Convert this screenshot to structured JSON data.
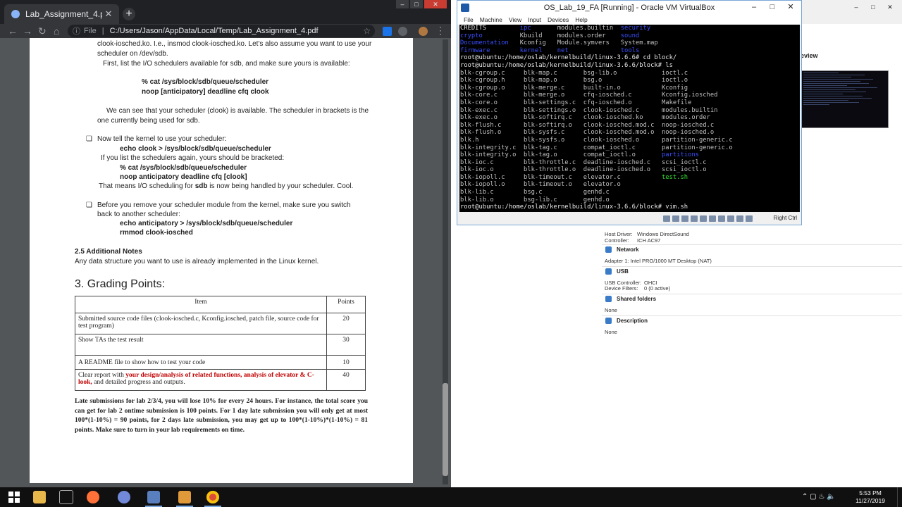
{
  "chrome": {
    "tab_title": "Lab_Assignment_4.pdf",
    "tab_close": "✕",
    "new_tab": "+",
    "omnibox_label": "File",
    "url": "C:/Users/Jason/AppData/Local/Temp/Lab_Assignment_4.pdf"
  },
  "pdf": {
    "line1": "clook-iosched.ko. I.e., insmod clook-iosched.ko. Let's also assume you want to use your",
    "line2": "scheduler on /dev/sdb.",
    "line3": "First, list the I/O schedulers available for sdb, and make sure yours is available:",
    "cmd1": "% cat /sys/block/sdb/queue/scheduler",
    "cmd1_out": "noop [anticipatory] deadline cfq clook",
    "para2_l1": "We can see that your scheduler (clook) is available. The scheduler in brackets is the",
    "para2_l2": "one currently being used for sdb.",
    "bullet1": "Now tell the kernel to use your scheduler:",
    "bullet1_cmd": "echo clook > /sys/block/sdb/queue/scheduler",
    "bullet1_l2": "If you list the schedulers again, yours should be bracketed:",
    "bullet1_cmd2": "% cat /sys/block/sdb/queue/scheduler",
    "bullet1_out": "noop anticipatory deadline cfq [clook]",
    "bullet1_l3_pre": "That means I/O scheduling for ",
    "bullet1_l3_bold": "sdb",
    "bullet1_l3_post": " is now being handled by your scheduler. Cool.",
    "bullet2_l1": "Before you remove your scheduler module from the kernel, make sure you switch",
    "bullet2_l2": "back to another scheduler:",
    "bullet2_cmd1": "echo anticipatory > /sys/block/sdb/queue/scheduler",
    "bullet2_cmd2": "rmmod clook-iosched",
    "notes_heading": "2.5 Additional Notes",
    "notes_text": "Any data structure you want to use is already implemented in the Linux kernel.",
    "grading_heading": "3. Grading Points:",
    "table_header_item": "Item",
    "table_header_points": "Points",
    "rows": [
      {
        "item": "Submitted source code files (clook-iosched.c, Kconfig.iosched, patch file, source code for test program)",
        "points": "20"
      },
      {
        "item": "Show TAs the test result",
        "points": "30"
      },
      {
        "item": "A README file to show how to test your code",
        "points": "10"
      }
    ],
    "row4_pre": "Clear report with ",
    "row4_red": "your design/analysis of related functions,  analysis of elevator & C-look,",
    "row4_post": " and detailed progress and outputs.",
    "row4_points": "40",
    "late_note": "Late submissions for lab 2/3/4, you will lose 10% for every 24 hours. For instance, the total score you can get for lab 2 ontime submission is 100 points. For 1 day late submission you will only get at most 100*(1-10%) = 90 points, for 2 days late submission, you may get up to 100*(1-10%)*(1-10%) = 81 points. Make sure to turn in your lab requirements on time."
  },
  "vbox": {
    "title": "OS_Lab_19_FA [Running] - Oracle VM VirtualBox",
    "menu": [
      "File",
      "Machine",
      "View",
      "Input",
      "Devices",
      "Help"
    ],
    "host_key": "Right Ctrl",
    "terminal": {
      "top": [
        [
          {
            "t": "CREDITS",
            "c": "w"
          },
          {
            "t": "         "
          },
          {
            "t": "ipc",
            "c": "b"
          },
          {
            "t": "       modules.builtin  "
          },
          {
            "t": "security",
            "c": "b"
          }
        ],
        [
          {
            "t": "crypto",
            "c": "b"
          },
          {
            "t": "          Kbuild    modules.order    "
          },
          {
            "t": "sound",
            "c": "b"
          }
        ],
        [
          {
            "t": "Documentation",
            "c": "b"
          },
          {
            "t": "   Kconfig   Module.symvers   System.map"
          }
        ],
        [
          {
            "t": "firmware",
            "c": "b"
          },
          {
            "t": "        "
          },
          {
            "t": "kernel",
            "c": "b"
          },
          {
            "t": "    "
          },
          {
            "t": "net",
            "c": "b"
          },
          {
            "t": "              "
          },
          {
            "t": "tools",
            "c": "b"
          }
        ],
        [
          {
            "t": "root@ubuntu:/home/oslab/kernelbuild/linux-3.6.6# cd block/",
            "c": "w"
          }
        ],
        [
          {
            "t": "root@ubuntu:/home/oslab/kernelbuild/linux-3.6.6/block# ls",
            "c": "w"
          }
        ]
      ],
      "ls": [
        [
          "blk-cgroup.c",
          "blk-map.c",
          "bsg-lib.o",
          "ioctl.c"
        ],
        [
          "blk-cgroup.h",
          "blk-map.o",
          "bsg.o",
          "ioctl.o"
        ],
        [
          "blk-cgroup.o",
          "blk-merge.c",
          "built-in.o",
          "Kconfig"
        ],
        [
          "blk-core.c",
          "blk-merge.o",
          "cfq-iosched.c",
          "Kconfig.iosched"
        ],
        [
          "blk-core.o",
          "blk-settings.c",
          "cfq-iosched.o",
          "Makefile"
        ],
        [
          "blk-exec.c",
          "blk-settings.o",
          "clook-iosched.c",
          "modules.builtin"
        ],
        [
          "blk-exec.o",
          "blk-softirq.c",
          "clook-iosched.ko",
          "modules.order"
        ],
        [
          "blk-flush.c",
          "blk-softirq.o",
          "clook-iosched.mod.c",
          "noop-iosched.c"
        ],
        [
          "blk-flush.o",
          "blk-sysfs.c",
          "clook-iosched.mod.o",
          "noop-iosched.o"
        ],
        [
          "blk.h",
          "blk-sysfs.o",
          "clook-iosched.o",
          "partition-generic.c"
        ],
        [
          "blk-integrity.c",
          "blk-tag.c",
          "compat_ioctl.c",
          "partition-generic.o"
        ],
        [
          "blk-integrity.o",
          "blk-tag.o",
          "compat_ioctl.o",
          "partitions"
        ],
        [
          "blk-ioc.c",
          "blk-throttle.c",
          "deadline-iosched.c",
          "scsi_ioctl.c"
        ],
        [
          "blk-ioc.o",
          "blk-throttle.o",
          "deadline-iosched.o",
          "scsi_ioctl.o"
        ],
        [
          "blk-iopoll.c",
          "blk-timeout.c",
          "elevator.c",
          "test.sh"
        ],
        [
          "blk-iopoll.o",
          "blk-timeout.o",
          "elevator.o",
          ""
        ],
        [
          "blk-lib.c",
          "bsg.c",
          "genhd.c",
          ""
        ],
        [
          "blk-lib.o",
          "bsg-lib.c",
          "genhd.o",
          ""
        ]
      ],
      "dir_entries": [
        "partitions"
      ],
      "exec_entries": [
        "test.sh"
      ],
      "prompt_last": "root@ubuntu:/home/oslab/kernelbuild/linux-3.6.6/block# vim.sh"
    }
  },
  "manager": {
    "preview_label": "eview",
    "host_driver_label": "Host Driver:",
    "host_driver": "Windows DirectSound",
    "controller_label": "Controller:",
    "controller": "ICH AC97",
    "network_heading": "Network",
    "adapter": "Adapter 1:   Intel PRO/1000 MT Desktop (NAT)",
    "usb_heading": "USB",
    "usb_controller_label": "USB Controller:",
    "usb_controller": "OHCI",
    "device_filters_label": "Device Filters:",
    "device_filters": "0 (0 active)",
    "shared_heading": "Shared folders",
    "shared_value": "None",
    "desc_heading": "Description",
    "desc_value": "None"
  },
  "taskbar": {
    "time": "5:53 PM",
    "date": "11/27/2019"
  }
}
